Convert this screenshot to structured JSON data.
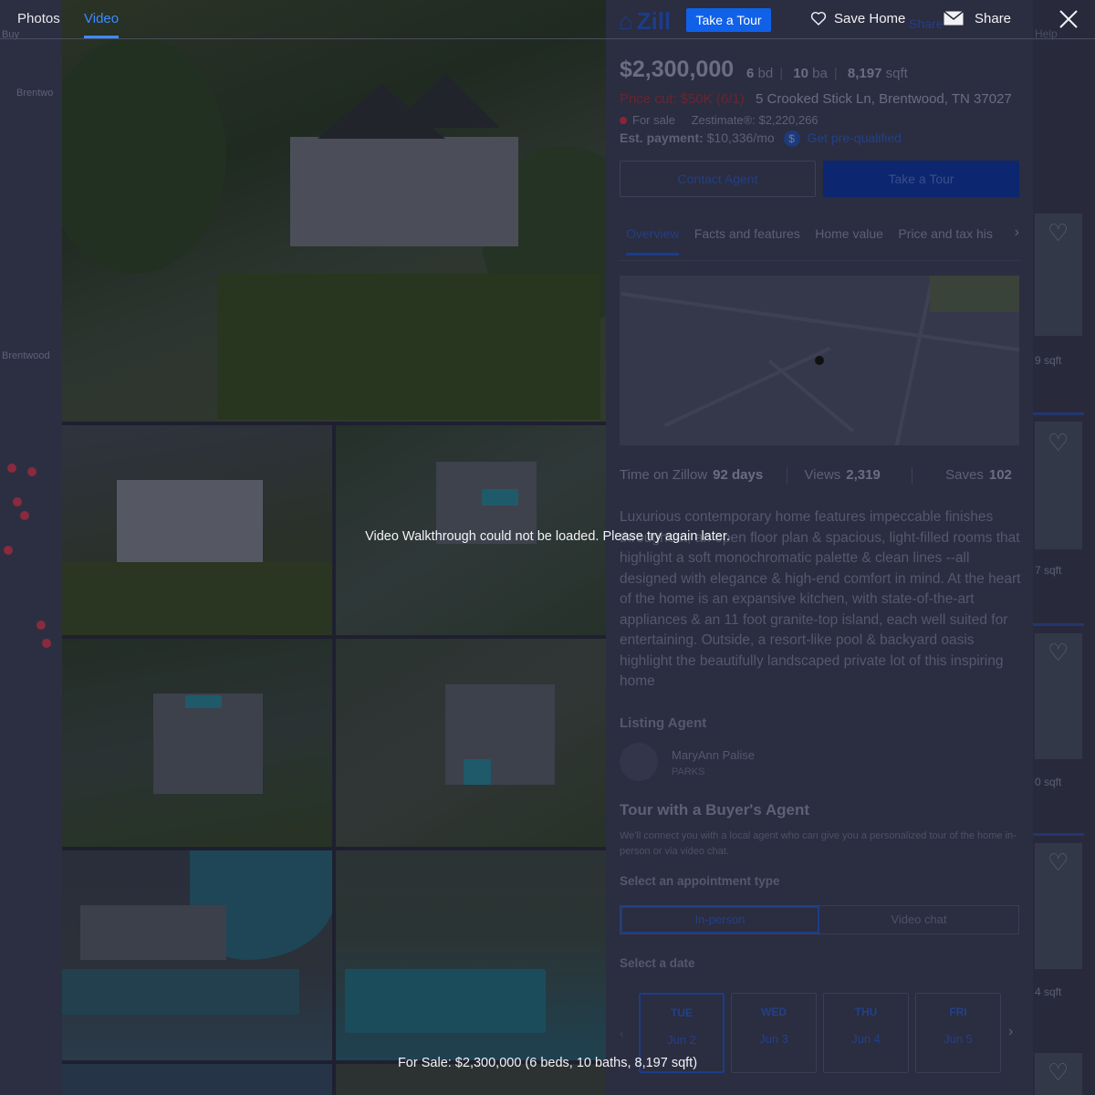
{
  "lightbox": {
    "tabs": [
      {
        "label": "Photos"
      },
      {
        "label": "Video"
      }
    ],
    "tour_button": "Take a Tour",
    "save_label": "Save Home",
    "share_label": "Share",
    "error_message": "Video Walkthrough could not be loaded. Please try again later.",
    "caption": "For Sale: $2,300,000 (6 beds, 10 baths, 8,197 sqft)"
  },
  "background": {
    "ghost": {
      "left_top": "Buy",
      "left_filter": "Brentwo",
      "left_map_label": "Brentwood",
      "right_top": "Help",
      "header_share": "Share"
    },
    "listing": {
      "logo": "Zill",
      "price": "$2,300,000",
      "beds": "6",
      "beds_unit": "bd",
      "baths": "10",
      "baths_unit": "ba",
      "sqft": "8,197",
      "sqft_unit": "sqft",
      "price_cut": "Price cut: $50K (6/1)",
      "address": "5 Crooked Stick Ln, Brentwood, TN 37027",
      "status": "For sale",
      "zestimate_label": "Zestimate®:",
      "zestimate_value": "$2,220,266",
      "est_payment_label": "Est. payment:",
      "est_payment_value": "$10,336/mo",
      "prequalify_link": "Get pre-qualified",
      "contact_button": "Contact Agent",
      "tour_button": "Take a Tour",
      "tabs": [
        "Overview",
        "Facts and features",
        "Home value",
        "Price and tax his"
      ],
      "stats": [
        {
          "label": "Time on Zillow",
          "value": "92 days"
        },
        {
          "label": "Views",
          "value": "2,319"
        },
        {
          "label": "Saves",
          "value": "102"
        }
      ],
      "description": "Luxurious contemporary home features impeccable finishes throughout, an open floor plan & spacious, light-filled rooms that highlight a soft monochromatic palette & clean lines --all designed with elegance & high-end comfort in mind. At the heart of the home is an expansive kitchen, with state-of-the-art appliances & an 11 foot granite-top island, each well suited for entertaining. Outside, a resort-like pool & backyard oasis highlight the beautifully landscaped private lot of this inspiring home",
      "listing_agent_heading": "Listing Agent",
      "agent_name": "MaryAnn Palise",
      "agent_firm": "PARKS",
      "tour_heading": "Tour with a Buyer's Agent",
      "tour_text": "We'll connect you with a local agent who can give you a personalized tour of the home in-person or via video chat.",
      "appointment_heading": "Select an appointment type",
      "appointment_options": [
        "In-person",
        "Video chat"
      ],
      "date_heading": "Select a date",
      "dates": [
        {
          "dow": "TUE",
          "day": "Jun 2"
        },
        {
          "dow": "WED",
          "day": "Jun 3"
        },
        {
          "dow": "THU",
          "day": "Jun 4"
        },
        {
          "dow": "FRI",
          "day": "Jun 5"
        }
      ]
    },
    "right_cards": [
      {
        "text": "9 sqft"
      },
      {
        "text": "7 sqft"
      },
      {
        "text": "0 sqft"
      },
      {
        "text": "4 sqft"
      }
    ]
  },
  "colors": {
    "accent": "#3d8bff",
    "tour_button": "#1061e8",
    "overlay_text": "#f4f4f7"
  },
  "icons": {
    "heart": "heart-outline-icon",
    "share": "envelope-icon",
    "close": "close-x-icon"
  }
}
